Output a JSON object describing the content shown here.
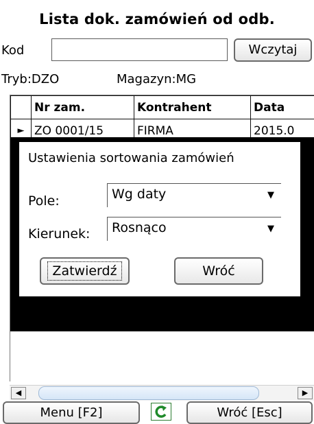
{
  "header": {
    "title": "Lista dok. zamówień od odb.",
    "kod_label": "Kod",
    "kod_value": "",
    "load_button": "Wczytaj",
    "tryb_label": "Tryb:",
    "tryb_value": "DZO",
    "magazyn_label": "Magazyn:",
    "magazyn_value": "MG"
  },
  "grid": {
    "columns": [
      "Nr zam.",
      "Kontrahent",
      "Data"
    ],
    "rows": [
      {
        "nr": "ZO 0001/15",
        "kontrahent": "FIRMA",
        "data": "2015.0"
      }
    ]
  },
  "dialog": {
    "title": "Ustawienia sortowania zamówień",
    "field_label": "Pole:",
    "field_value": "Wg daty",
    "direction_label": "Kierunek:",
    "direction_value": "Rosnąco",
    "confirm_button": "Zatwierdź",
    "back_button": "Wróć"
  },
  "footer": {
    "menu_button": "Menu  [F2]",
    "back_button": "Wróć [Esc]",
    "refresh_icon": "refresh-icon"
  },
  "colors": {
    "dialog_frame": "#000000",
    "refresh_green": "#1f8a2a",
    "scroll_thumb": "#d6e6f7"
  }
}
